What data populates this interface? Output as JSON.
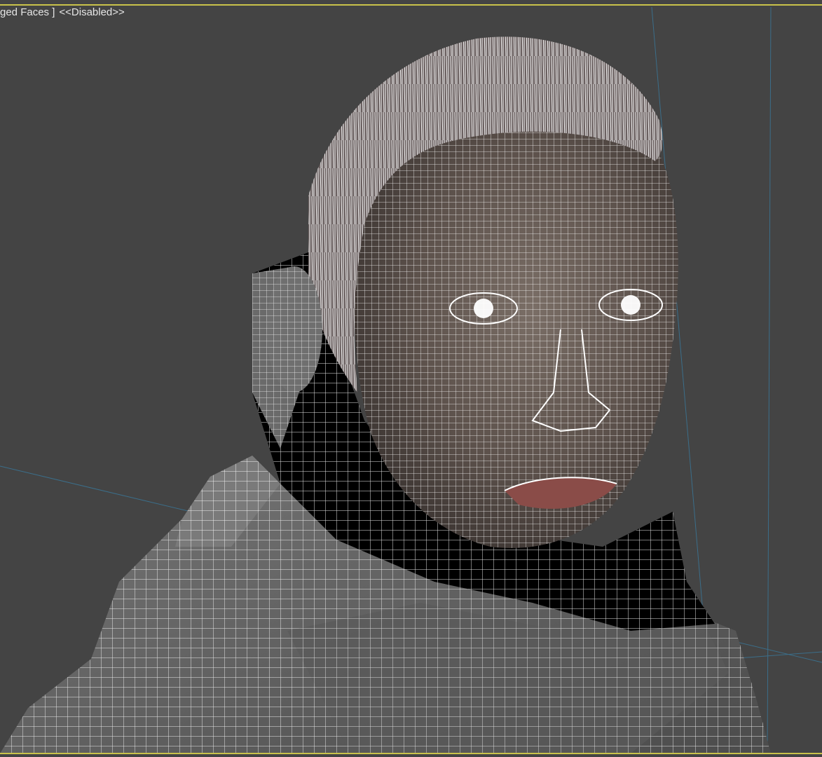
{
  "viewport": {
    "label_faces": "ged Faces ]",
    "label_state": "<<Disabled>>",
    "border_color": "#c9c24a",
    "background_color": "#444444",
    "wire_color": "#ffffff"
  },
  "scene": {
    "object": "wireframe-character-head",
    "icons": [
      "viewport-label",
      "wireframe-mesh"
    ]
  }
}
